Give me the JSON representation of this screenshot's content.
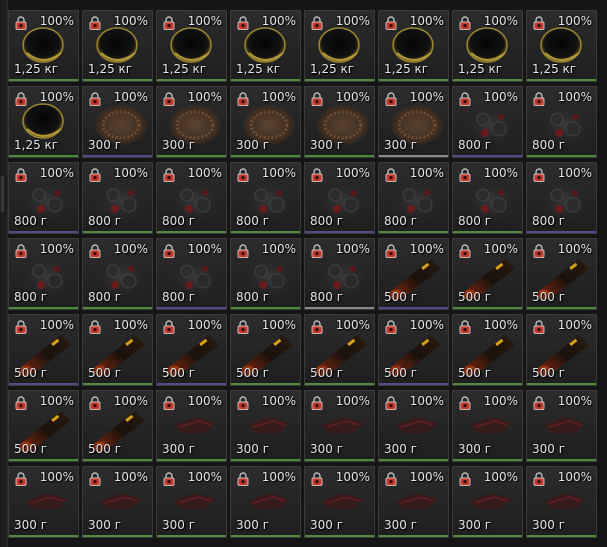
{
  "colors": {
    "slot_bg": "#262626",
    "slot_border": "#3b3b3b",
    "text": "#e6e6e6",
    "lock_red": "#c0392b",
    "rarity_green": "#4f8a3c",
    "rarity_purple": "#5a4a8c",
    "rarity_white": "#8a8a8a"
  },
  "inventory": {
    "items": [
      {
        "icon": "dark-helmet-icon",
        "condition": "100%",
        "weight": "1,25 кг",
        "rarity": "green"
      },
      {
        "icon": "dark-helmet-icon",
        "condition": "100%",
        "weight": "1,25 кг",
        "rarity": "green"
      },
      {
        "icon": "dark-helmet-icon",
        "condition": "100%",
        "weight": "1,25 кг",
        "rarity": "green"
      },
      {
        "icon": "dark-helmet-icon",
        "condition": "100%",
        "weight": "1,25 кг",
        "rarity": "green"
      },
      {
        "icon": "dark-helmet-icon",
        "condition": "100%",
        "weight": "1,25 кг",
        "rarity": "green"
      },
      {
        "icon": "dark-helmet-icon",
        "condition": "100%",
        "weight": "1,25 кг",
        "rarity": "green"
      },
      {
        "icon": "dark-helmet-icon",
        "condition": "100%",
        "weight": "1,25 кг",
        "rarity": "green"
      },
      {
        "icon": "dark-helmet-icon",
        "condition": "100%",
        "weight": "1,25 кг",
        "rarity": "green"
      },
      {
        "icon": "dark-helmet-icon",
        "condition": "100%",
        "weight": "1,25 кг",
        "rarity": "green"
      },
      {
        "icon": "brown-material-icon",
        "condition": "100%",
        "weight": "300 г",
        "rarity": "purple"
      },
      {
        "icon": "brown-material-icon",
        "condition": "100%",
        "weight": "300 г",
        "rarity": "green"
      },
      {
        "icon": "brown-material-icon",
        "condition": "100%",
        "weight": "300 г",
        "rarity": "green"
      },
      {
        "icon": "brown-material-icon",
        "condition": "100%",
        "weight": "300 г",
        "rarity": "green"
      },
      {
        "icon": "brown-material-icon",
        "condition": "100%",
        "weight": "300 г",
        "rarity": "white"
      },
      {
        "icon": "dark-mechanism-icon",
        "condition": "100%",
        "weight": "800 г",
        "rarity": "purple"
      },
      {
        "icon": "dark-mechanism-icon",
        "condition": "100%",
        "weight": "800 г",
        "rarity": "green"
      },
      {
        "icon": "dark-mechanism-icon",
        "condition": "100%",
        "weight": "800 г",
        "rarity": "purple"
      },
      {
        "icon": "dark-mechanism-icon",
        "condition": "100%",
        "weight": "800 г",
        "rarity": "green"
      },
      {
        "icon": "dark-mechanism-icon",
        "condition": "100%",
        "weight": "800 г",
        "rarity": "green"
      },
      {
        "icon": "dark-mechanism-icon",
        "condition": "100%",
        "weight": "800 г",
        "rarity": "green"
      },
      {
        "icon": "dark-mechanism-icon",
        "condition": "100%",
        "weight": "800 г",
        "rarity": "purple"
      },
      {
        "icon": "dark-mechanism-icon",
        "condition": "100%",
        "weight": "800 г",
        "rarity": "green"
      },
      {
        "icon": "dark-mechanism-icon",
        "condition": "100%",
        "weight": "800 г",
        "rarity": "green"
      },
      {
        "icon": "dark-mechanism-icon",
        "condition": "100%",
        "weight": "800 г",
        "rarity": "purple"
      },
      {
        "icon": "dark-mechanism-icon",
        "condition": "100%",
        "weight": "800 г",
        "rarity": "green"
      },
      {
        "icon": "dark-mechanism-icon",
        "condition": "100%",
        "weight": "800 г",
        "rarity": "green"
      },
      {
        "icon": "dark-mechanism-icon",
        "condition": "100%",
        "weight": "800 г",
        "rarity": "purple"
      },
      {
        "icon": "dark-mechanism-icon",
        "condition": "100%",
        "weight": "800 г",
        "rarity": "green"
      },
      {
        "icon": "dark-mechanism-icon",
        "condition": "100%",
        "weight": "800 г",
        "rarity": "white"
      },
      {
        "icon": "orange-tube-icon",
        "condition": "100%",
        "weight": "500 г",
        "rarity": "purple"
      },
      {
        "icon": "orange-tube-icon",
        "condition": "100%",
        "weight": "500 г",
        "rarity": "green"
      },
      {
        "icon": "orange-tube-icon",
        "condition": "100%",
        "weight": "500 г",
        "rarity": "green"
      },
      {
        "icon": "orange-tube-icon",
        "condition": "100%",
        "weight": "500 г",
        "rarity": "purple"
      },
      {
        "icon": "orange-tube-icon",
        "condition": "100%",
        "weight": "500 г",
        "rarity": "green"
      },
      {
        "icon": "orange-tube-icon",
        "condition": "100%",
        "weight": "500 г",
        "rarity": "purple"
      },
      {
        "icon": "orange-tube-icon",
        "condition": "100%",
        "weight": "500 г",
        "rarity": "green"
      },
      {
        "icon": "orange-tube-icon",
        "condition": "100%",
        "weight": "500 г",
        "rarity": "green"
      },
      {
        "icon": "orange-tube-icon",
        "condition": "100%",
        "weight": "500 г",
        "rarity": "purple"
      },
      {
        "icon": "orange-tube-icon",
        "condition": "100%",
        "weight": "500 г",
        "rarity": "green"
      },
      {
        "icon": "orange-tube-icon",
        "condition": "100%",
        "weight": "500 г",
        "rarity": "green"
      },
      {
        "icon": "orange-tube-icon",
        "condition": "100%",
        "weight": "500 г",
        "rarity": "green"
      },
      {
        "icon": "orange-tube-icon",
        "condition": "100%",
        "weight": "500 г",
        "rarity": "green"
      },
      {
        "icon": "red-scrap-icon",
        "condition": "100%",
        "weight": "300 г",
        "rarity": "green"
      },
      {
        "icon": "red-scrap-icon",
        "condition": "100%",
        "weight": "300 г",
        "rarity": "green"
      },
      {
        "icon": "red-scrap-icon",
        "condition": "100%",
        "weight": "300 г",
        "rarity": "green"
      },
      {
        "icon": "red-scrap-icon",
        "condition": "100%",
        "weight": "300 г",
        "rarity": "green"
      },
      {
        "icon": "red-scrap-icon",
        "condition": "100%",
        "weight": "300 г",
        "rarity": "green"
      },
      {
        "icon": "red-scrap-icon",
        "condition": "100%",
        "weight": "300 г",
        "rarity": "green"
      },
      {
        "icon": "red-scrap-icon",
        "condition": "100%",
        "weight": "300 г",
        "rarity": "green"
      },
      {
        "icon": "red-scrap-icon",
        "condition": "100%",
        "weight": "300 г",
        "rarity": "green"
      },
      {
        "icon": "red-scrap-icon",
        "condition": "100%",
        "weight": "300 г",
        "rarity": "green"
      },
      {
        "icon": "red-scrap-icon",
        "condition": "100%",
        "weight": "300 г",
        "rarity": "green"
      },
      {
        "icon": "red-scrap-icon",
        "condition": "100%",
        "weight": "300 г",
        "rarity": "green"
      },
      {
        "icon": "red-scrap-icon",
        "condition": "100%",
        "weight": "300 г",
        "rarity": "green"
      },
      {
        "icon": "red-scrap-icon",
        "condition": "100%",
        "weight": "300 г",
        "rarity": "green"
      },
      {
        "icon": "red-scrap-icon",
        "condition": "100%",
        "weight": "300 г",
        "rarity": "green"
      }
    ]
  }
}
